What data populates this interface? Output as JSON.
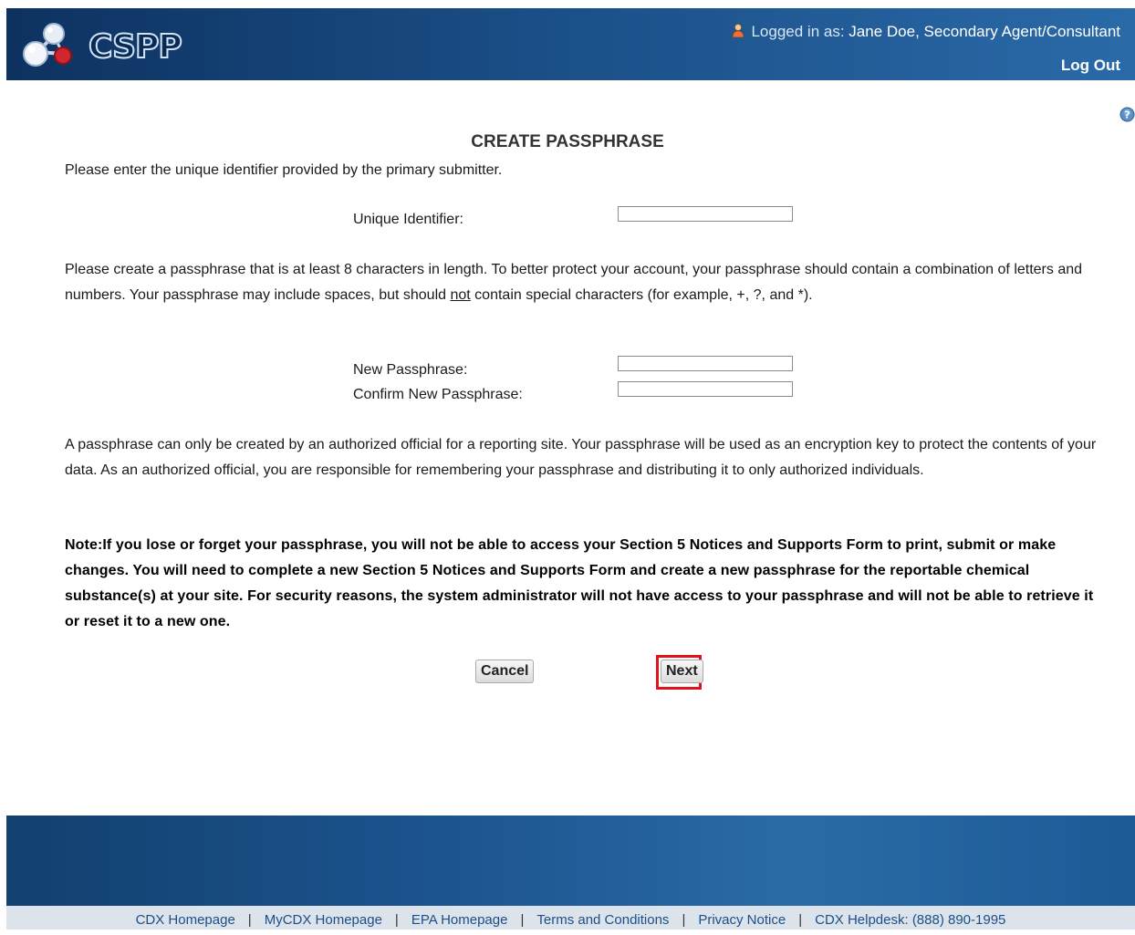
{
  "header": {
    "logo_text": "CSPP",
    "logged_in_label": "Logged in as:",
    "user_name": "Jane Doe, Secondary Agent/Consultant",
    "logout_label": "Log Out"
  },
  "main": {
    "title": "CREATE PASSPHRASE",
    "intro": "Please enter the unique identifier provided by the primary submitter.",
    "unique_identifier_label": "Unique Identifier:",
    "unique_identifier_value": "",
    "instructions_part1": "Please create a passphrase that is at least 8 characters in length. To better protect your account, your passphrase should contain a combination of letters and numbers. Your passphrase may include spaces, but should ",
    "instructions_emphasis": "not",
    "instructions_part2": " contain special characters (for example, +, ?, and *).",
    "new_passphrase_label": "New Passphrase:",
    "new_passphrase_value": "",
    "confirm_passphrase_label": "Confirm New Passphrase:",
    "confirm_passphrase_value": "",
    "official_text": "A passphrase can only be created by an authorized official for a reporting site. Your passphrase will be used as an encryption key to protect the contents of your data. As an authorized official, you are responsible for remembering your passphrase and distributing it to only authorized individuals.",
    "note_text": "Note:If you lose or forget your passphrase, you will not be able to access your Section 5 Notices and Supports Form to print, submit or make changes. You will need to complete a new Section 5 Notices and Supports Form and create a new passphrase for the reportable chemical substance(s) at your site. For security reasons, the system administrator will not have access to your passphrase and will not be able to retrieve it or reset it to a new one."
  },
  "buttons": {
    "cancel_label": "Cancel",
    "next_label": "Next"
  },
  "footer": {
    "links": [
      "CDX Homepage",
      "MyCDX Homepage",
      "EPA Homepage",
      "Terms and Conditions",
      "Privacy Notice",
      "CDX Helpdesk: (888) 890-1995"
    ]
  },
  "icons": {
    "logo": "molecule-logo-icon",
    "user": "user-icon",
    "help": "help-icon"
  },
  "colors": {
    "header_dark": "#0d3260",
    "header_light": "#2a6aa8",
    "highlight_border": "#e0131a",
    "link": "#1a4f8a"
  }
}
